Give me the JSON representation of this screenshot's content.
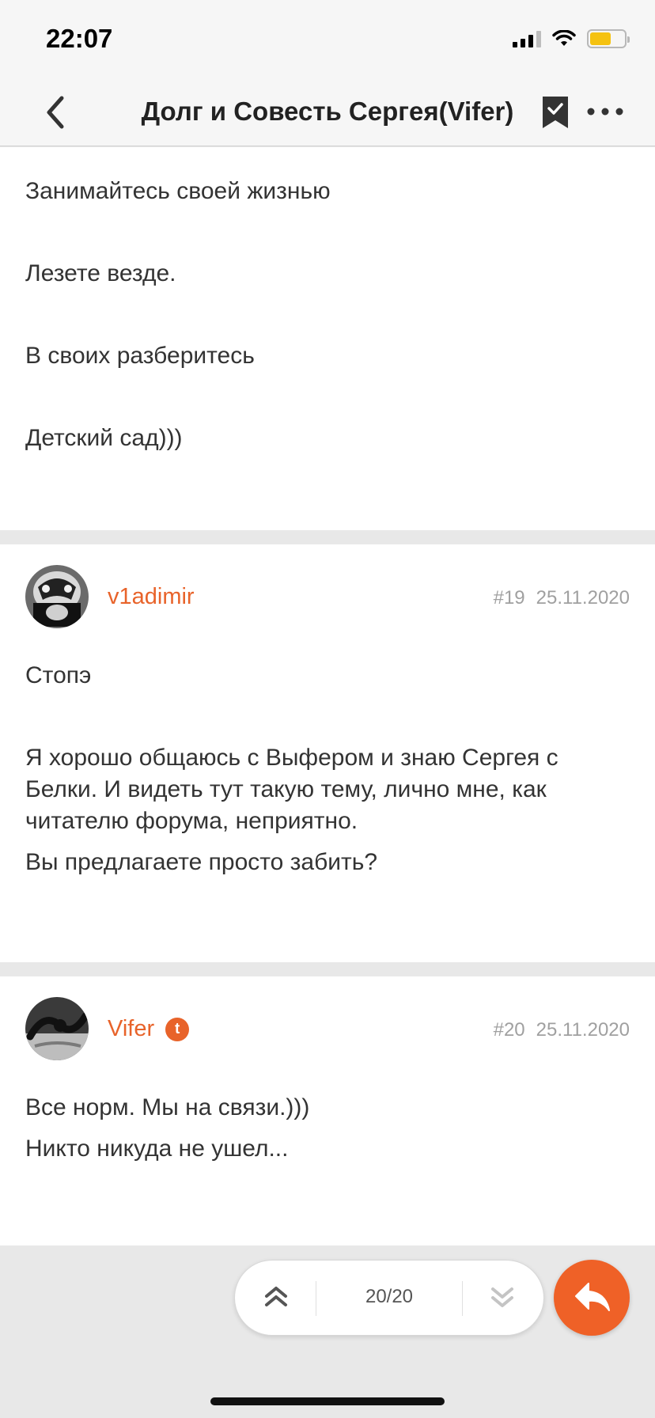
{
  "status_bar": {
    "time": "22:07"
  },
  "nav": {
    "title": "Долг и Совесть Сергея(Vifer)"
  },
  "first_post": {
    "paragraphs": [
      "Занимайтесь своей жизнью",
      "Лезете везде.",
      "В своих разберитесь",
      "Детский сад)))"
    ]
  },
  "posts": [
    {
      "author": "v1adimir",
      "number": "#19",
      "date": "25.11.2020",
      "paragraphs": [
        "Стопэ",
        "Я хорошо общаюсь с Выфером и знаю Сергея с Белки. И видеть тут такую тему, лично мне, как читателю форума, неприятно.",
        "Вы предлагаете просто забить?"
      ]
    },
    {
      "author": "Vifer",
      "author_badge_icon": "topic-starter-icon",
      "number": "#20",
      "date": "25.11.2020",
      "paragraphs": [
        "Все норм. Мы на связи.)))",
        "Никто никуда не ушел..."
      ]
    }
  ],
  "pager": {
    "count": "20/20"
  },
  "colors": {
    "accent": "#ef6127",
    "username": "#e8632a"
  }
}
